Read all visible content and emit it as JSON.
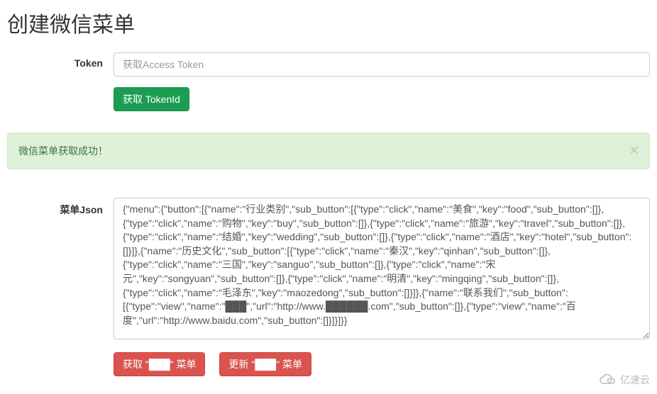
{
  "page": {
    "title": "创建微信菜单"
  },
  "form": {
    "token_label": "Token",
    "token_placeholder": "获取Access Token",
    "get_token_btn": "获取 TokenId",
    "json_label": "菜单Json",
    "json_value": "{\"menu\":{\"button\":[{\"name\":\"行业类别\",\"sub_button\":[{\"type\":\"click\",\"name\":\"美食\",\"key\":\"food\",\"sub_button\":[]},{\"type\":\"click\",\"name\":\"购物\",\"key\":\"buy\",\"sub_button\":[]},{\"type\":\"click\",\"name\":\"旅游\",\"key\":\"travel\",\"sub_button\":[]},{\"type\":\"click\",\"name\":\"结婚\",\"key\":\"wedding\",\"sub_button\":[]},{\"type\":\"click\",\"name\":\"酒店\",\"key\":\"hotel\",\"sub_button\":[]}]},{\"name\":\"历史文化\",\"sub_button\":[{\"type\":\"click\",\"name\":\"秦汉\",\"key\":\"qinhan\",\"sub_button\":[]},{\"type\":\"click\",\"name\":\"三国\",\"key\":\"sanguo\",\"sub_button\":[]},{\"type\":\"click\",\"name\":\"宋元\",\"key\":\"songyuan\",\"sub_button\":[]},{\"type\":\"click\",\"name\":\"明清\",\"key\":\"mingqing\",\"sub_button\":[]},{\"type\":\"click\",\"name\":\"毛泽东\",\"key\":\"maozedong\",\"sub_button\":[]}]},{\"name\":\"联系我们\",\"sub_button\":[{\"type\":\"view\",\"name\":\"███\",\"url\":\"http://www.██████.com\",\"sub_button\":[]},{\"type\":\"view\",\"name\":\"百度\",\"url\":\"http://www.baidu.com\",\"sub_button\":[]}]}]}}",
    "get_menu_btn": "获取 \"███\" 菜单",
    "update_menu_btn": "更新 \"███\" 菜单"
  },
  "alert": {
    "message": "微信菜单获取成功！",
    "close": "×"
  },
  "watermark": {
    "text": "亿速云"
  }
}
